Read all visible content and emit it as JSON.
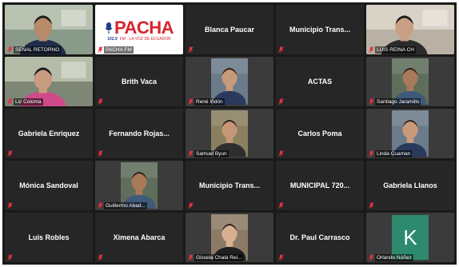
{
  "tiles": [
    {
      "name": "SEÑAL RETORNO",
      "label": "SEÑAL RETORNO",
      "kind": "video-full",
      "muted": true
    },
    {
      "name": "PACHA FM",
      "label": "PACHA FM",
      "kind": "logo",
      "muted": true,
      "logo": {
        "brand": "PACHA",
        "freq": "102.9",
        "tagline": "FM · LA VOZ DE ECUADOR"
      }
    },
    {
      "name": "Blanca Paucar",
      "kind": "name",
      "muted": true
    },
    {
      "name": "Municipio Trans...",
      "kind": "name",
      "muted": true
    },
    {
      "name": "LUIS REINA CH",
      "label": "LUIS REINA CH",
      "kind": "video-full",
      "muted": true
    },
    {
      "name": "Liz Coloma",
      "label": "Liz Coloma",
      "kind": "video-full",
      "muted": true
    },
    {
      "name": "Brith Vaca",
      "kind": "name",
      "muted": true
    },
    {
      "name": "René Iñdón",
      "label": "René Iñdón",
      "kind": "video-thumb",
      "muted": true
    },
    {
      "name": "ACTAS",
      "kind": "name",
      "muted": true
    },
    {
      "name": "Santiago Jaramillo",
      "label": "Santiago Jaramillo",
      "kind": "video-thumb",
      "muted": true
    },
    {
      "name": "Gabriela Enriquez",
      "kind": "name",
      "muted": true
    },
    {
      "name": "Fernando Rojas...",
      "kind": "name",
      "muted": true
    },
    {
      "name": "Samuel Byun",
      "label": "Samuel Byun",
      "kind": "video-thumb",
      "muted": true
    },
    {
      "name": "Carlos Poma",
      "kind": "name",
      "muted": true
    },
    {
      "name": "Linda Cuaman",
      "label": "Linda Cuaman",
      "kind": "video-thumb",
      "muted": true
    },
    {
      "name": "Mónica Sandoval",
      "kind": "name",
      "muted": true
    },
    {
      "name": "Guillermo Abad...",
      "label": "Guillermo Abad...",
      "kind": "video-thumb",
      "muted": true
    },
    {
      "name": "Municipio Trans...",
      "kind": "name",
      "muted": true
    },
    {
      "name": "MUNICIPAL 720...",
      "kind": "name",
      "muted": true
    },
    {
      "name": "Gabriela Llanos",
      "kind": "name",
      "muted": true
    },
    {
      "name": "Luis Robles",
      "kind": "name",
      "muted": true
    },
    {
      "name": "Ximena Abarca",
      "kind": "name",
      "muted": true
    },
    {
      "name": "Gissela Chalá Rei...",
      "label": "Gissela Chalá Rei...",
      "kind": "video-thumb",
      "muted": true
    },
    {
      "name": "Dr. Paul Carrasco",
      "kind": "name",
      "muted": true
    },
    {
      "name": "Orlando Núñez",
      "label": "Orlando Núñez",
      "kind": "avatar",
      "avatar_letter": "K",
      "muted": true
    }
  ],
  "colors": {
    "grid_bg": "#1a1a1a",
    "tile_bg": "#262626",
    "mute_icon": "#e8343c",
    "avatar_bg": "#2d8a6e",
    "brand_red": "#d6262b"
  }
}
